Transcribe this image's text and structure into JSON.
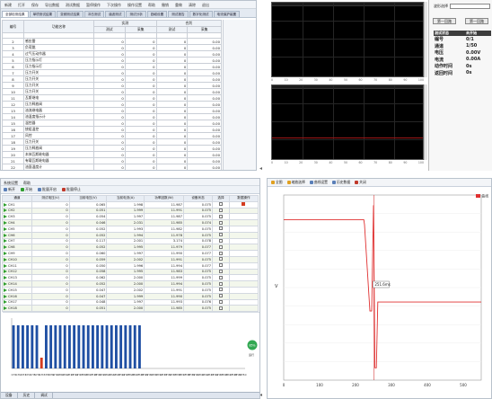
{
  "top_left": {
    "menu": [
      "新建",
      "打开",
      "保存",
      "导出数据",
      "测试数据",
      "暂停操作",
      "下次操作",
      "操作设置",
      "帮助",
      "撤销",
      "重做",
      "清除",
      "退出"
    ],
    "tabs": [
      "全部检测结果",
      "单项测试结果",
      "变频测试结果",
      "冲击测试",
      "谐波测试",
      "测试分析",
      "励磁设置",
      "测试报告",
      "数字化测试",
      "电流保护装置"
    ],
    "col_headers": {
      "no": "编号",
      "name": "功能名称",
      "group1": "实测",
      "group2": "合判",
      "sub1": "测试",
      "sub2": "采集",
      "sub3": "测试",
      "sub4": "采集"
    },
    "rows": [
      {
        "no": "",
        "name": "",
        "a": "",
        "b": "",
        "c": "",
        "d": ""
      },
      {
        "no": "2",
        "name": "感应雷",
        "a": "0",
        "b": "0",
        "c": "0",
        "d": "0.00"
      },
      {
        "no": "3",
        "name": "负荷跳",
        "a": "0",
        "b": "0",
        "c": "0",
        "d": "0.00"
      },
      {
        "no": "4",
        "name": "过气压动作器",
        "a": "0",
        "b": "0",
        "c": "0",
        "d": "0.00"
      },
      {
        "no": "5",
        "name": "压力指示灯",
        "a": "0",
        "b": "0",
        "c": "0",
        "d": "0.00"
      },
      {
        "no": "6",
        "name": "压力指示灯",
        "a": "0",
        "b": "0",
        "c": "0",
        "d": "0.00"
      },
      {
        "no": "7",
        "name": "压力开关",
        "a": "0",
        "b": "0",
        "c": "0",
        "d": "0.00"
      },
      {
        "no": "8",
        "name": "压力开关",
        "a": "0",
        "b": "0",
        "c": "0",
        "d": "0.00"
      },
      {
        "no": "9",
        "name": "压力开关",
        "a": "0",
        "b": "0",
        "c": "0",
        "d": "0.00"
      },
      {
        "no": "10",
        "name": "压力开关",
        "a": "0",
        "b": "0",
        "c": "0",
        "d": "0.00"
      },
      {
        "no": "11",
        "name": "瓦斯继电",
        "a": "0",
        "b": "0",
        "c": "0",
        "d": "0.00"
      },
      {
        "no": "12",
        "name": "压力释放阀",
        "a": "0",
        "b": "0",
        "c": "0",
        "d": "0.00"
      },
      {
        "no": "13",
        "name": "油流继电器",
        "a": "0",
        "b": "0",
        "c": "0",
        "d": "0.00"
      },
      {
        "no": "14",
        "name": "油温度指示计",
        "a": "0",
        "b": "0",
        "c": "0",
        "d": "0.00"
      },
      {
        "no": "15",
        "name": "温控器",
        "a": "0",
        "b": "0",
        "c": "0",
        "d": "0.00"
      },
      {
        "no": "16",
        "name": "绕组温控",
        "a": "0",
        "b": "0",
        "c": "0",
        "d": "0.00"
      },
      {
        "no": "17",
        "name": "风控",
        "a": "0",
        "b": "0",
        "c": "0",
        "d": "0.00"
      },
      {
        "no": "18",
        "name": "压力开关",
        "a": "0",
        "b": "0",
        "c": "0",
        "d": "0.00"
      },
      {
        "no": "19",
        "name": "压力释放阀",
        "a": "0",
        "b": "0",
        "c": "0",
        "d": "0.00"
      },
      {
        "no": "20",
        "name": "本体瓦斯继电器",
        "a": "0",
        "b": "0",
        "c": "0",
        "d": "0.00"
      },
      {
        "no": "21",
        "name": "有载瓦斯继电器",
        "a": "0",
        "b": "0",
        "c": "0",
        "d": "0.00"
      },
      {
        "no": "22",
        "name": "油面温度计",
        "a": "0",
        "b": "0",
        "c": "0",
        "d": "0.00"
      },
      {
        "no": "23",
        "name": "绕组温度计(高)",
        "a": "0",
        "b": "0",
        "c": "0",
        "d": "0.00"
      },
      {
        "no": "24",
        "name": "绕组温度计(低)",
        "a": "0",
        "b": "0",
        "c": "0",
        "d": "0.00"
      },
      {
        "no": "25",
        "name": "本体油位计",
        "a": "0",
        "b": "0",
        "c": "0",
        "d": "0.00"
      }
    ]
  },
  "top_right": {
    "select_label": "波形选择",
    "btn_prev": "第一回路",
    "btn_next": "第一回路",
    "result_head": [
      "测试状态",
      "未开始"
    ],
    "results": [
      {
        "k": "编号",
        "v": "0/1"
      },
      {
        "k": "通道",
        "v": "1/50"
      },
      {
        "k": "电压",
        "v": "0.00V"
      },
      {
        "k": "电流",
        "v": "0.00A"
      },
      {
        "k": "动作时间",
        "v": "0s"
      },
      {
        "k": "返回时间",
        "v": "0s"
      }
    ],
    "x_ticks": [
      "0",
      "10",
      "20",
      "30",
      "40",
      "50",
      "60",
      "70",
      "80",
      "90",
      "100"
    ]
  },
  "bottom_left": {
    "menu": [
      "系统设置",
      "帮助"
    ],
    "toolbar": [
      "新开",
      "开始",
      "批量开启",
      "批量停止"
    ],
    "headers": [
      "通道",
      "测试电压(V)",
      "当前电压(V)",
      "当前电流(A)",
      "功率因数(W)",
      "设备状态",
      "选择",
      "数据操作"
    ],
    "channels": [
      {
        "ch": "CH1",
        "v1": "0",
        "v2": "0.065",
        "v3": "1.998",
        "v4": "11.987",
        "v5": "0.075"
      },
      {
        "ch": "CH2",
        "v1": "0",
        "v2": "0.051",
        "v3": "1.999",
        "v4": "11.991",
        "v5": "0.075"
      },
      {
        "ch": "CH3",
        "v1": "0",
        "v2": "0.054",
        "v3": "1.997",
        "v4": "11.987",
        "v5": "0.075"
      },
      {
        "ch": "CH4",
        "v1": "0",
        "v2": "0.046",
        "v3": "2.031",
        "v4": "11.985",
        "v5": "0.074"
      },
      {
        "ch": "CH5",
        "v1": "0",
        "v2": "0.052",
        "v3": "1.993",
        "v4": "11.982",
        "v5": "0.075"
      },
      {
        "ch": "CH6",
        "v1": "0",
        "v2": "0.052",
        "v3": "1.994",
        "v4": "11.978",
        "v5": "0.075"
      },
      {
        "ch": "CH7",
        "v1": "0",
        "v2": "0.117",
        "v3": "2.001",
        "v4": "3.174",
        "v5": "0.078"
      },
      {
        "ch": "CH8",
        "v1": "0",
        "v2": "0.052",
        "v3": "1.995",
        "v4": "11.979",
        "v5": "0.077"
      },
      {
        "ch": "CH9",
        "v1": "0",
        "v2": "0.060",
        "v3": "1.997",
        "v4": "11.990",
        "v5": "0.077"
      },
      {
        "ch": "CH10",
        "v1": "0",
        "v2": "0.059",
        "v3": "2.002",
        "v4": "11.991",
        "v5": "0.075"
      },
      {
        "ch": "CH11",
        "v1": "0",
        "v2": "0.050",
        "v3": "1.996",
        "v4": "11.994",
        "v5": "0.077"
      },
      {
        "ch": "CH12",
        "v1": "0",
        "v2": "0.058",
        "v3": "1.995",
        "v4": "11.983",
        "v5": "0.075"
      },
      {
        "ch": "CH13",
        "v1": "0",
        "v2": "0.062",
        "v3": "2.000",
        "v4": "11.999",
        "v5": "0.075"
      },
      {
        "ch": "CH14",
        "v1": "0",
        "v2": "0.052",
        "v3": "2.000",
        "v4": "11.994",
        "v5": "0.075"
      },
      {
        "ch": "CH15",
        "v1": "0",
        "v2": "0.047",
        "v3": "2.002",
        "v4": "11.991",
        "v5": "0.075"
      },
      {
        "ch": "CH16",
        "v1": "0",
        "v2": "0.047",
        "v3": "1.999",
        "v4": "11.990",
        "v5": "0.075"
      },
      {
        "ch": "CH17",
        "v1": "0",
        "v2": "0.048",
        "v3": "1.997",
        "v4": "11.993",
        "v5": "0.076"
      },
      {
        "ch": "CH18",
        "v1": "0",
        "v2": "0.051",
        "v3": "2.000",
        "v4": "11.985",
        "v5": "0.075"
      }
    ],
    "bottom_tabs": [
      "设备",
      "历史",
      "调试"
    ],
    "legend_label": "CH",
    "gauge_label": "85%",
    "status_label": "运行"
  },
  "bottom_right": {
    "toolbar": [
      "全图",
      "缩放选择",
      "曲线设置",
      "历史数据",
      "关闭"
    ],
    "y_label": "V",
    "tooltip": "251.6ms",
    "legend": "曲线",
    "x_ticks": [
      "0",
      "100",
      "200",
      "300",
      "400",
      "500"
    ]
  },
  "chart_data": [
    {
      "type": "bar",
      "categories": [
        "CH1",
        "CH2",
        "CH3",
        "CH4",
        "CH5",
        "CH6",
        "CH7",
        "CH8",
        "CH9",
        "CH10",
        "CH11",
        "CH12",
        "CH13",
        "CH14",
        "CH15",
        "CH16",
        "CH17",
        "CH18",
        "CH19",
        "CH20",
        "CH21",
        "CH22",
        "CH23",
        "CH24",
        "CH25",
        "CH26",
        "CH27",
        "CH28",
        "CH29",
        "CH30",
        "CH31",
        "CH32",
        "CH33",
        "CH34",
        "CH35",
        "CH36",
        "CH37",
        "CH38",
        "CH39",
        "CH40",
        "CH41",
        "CH42",
        "CH43",
        "CH44",
        "CH45",
        "CH46",
        "CH47",
        "CH48",
        "CH49",
        "CH50"
      ],
      "series": [
        {
          "name": "",
          "values": [
            12,
            12,
            12,
            12,
            12,
            12,
            3,
            12,
            12,
            12,
            12,
            12,
            12,
            12,
            12,
            12,
            12,
            12,
            12,
            12,
            12,
            12,
            12,
            12,
            12,
            12,
            12,
            12,
            0,
            0,
            0,
            0,
            0,
            0,
            0,
            0,
            0,
            0,
            0,
            0,
            0,
            0,
            0,
            0,
            0,
            0,
            0,
            0,
            0,
            0
          ]
        }
      ],
      "ylim": [
        0,
        14
      ],
      "highlight": {
        "index": 6,
        "color": "#d43b1f"
      },
      "color": "#1f4fa3"
    },
    {
      "type": "line",
      "x": [
        0,
        120,
        180,
        223,
        225,
        240,
        245,
        250,
        254,
        258,
        262,
        266,
        270,
        280,
        300,
        550
      ],
      "y": [
        170,
        170,
        170,
        170,
        158,
        -52,
        -52,
        205,
        -190,
        -190,
        -30,
        -30,
        -30,
        -30,
        -30,
        -30
      ],
      "xlim": [
        0,
        550
      ],
      "ylim": [
        -220,
        230
      ],
      "color": "#e03030",
      "cursor_x": 251
    }
  ]
}
